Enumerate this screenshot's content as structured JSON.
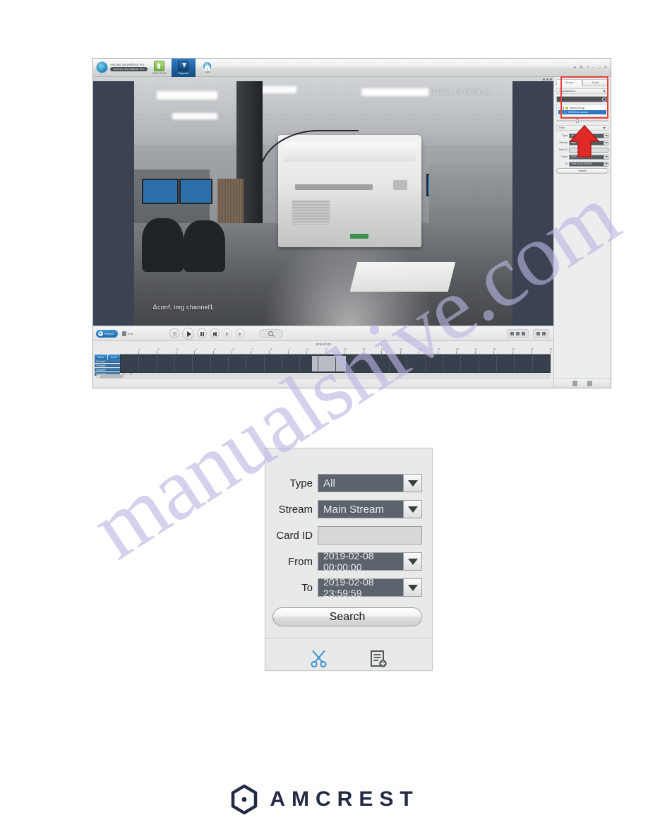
{
  "watermark": {
    "text": "manualshive.com"
  },
  "app": {
    "brand": {
      "name": "Amcrest Surveillance Pro",
      "subtitle": "Amcrest Surveillance Pro"
    },
    "tabs": [
      {
        "label": "HOME PAGE",
        "icon": "home-icon",
        "active": false
      },
      {
        "label": "Playback",
        "icon": "playback-icon",
        "active": true
      },
      {
        "label": "Add",
        "icon": "plus-icon",
        "active": false
      }
    ],
    "window_controls": [
      "minimize",
      "maximize",
      "close"
    ],
    "video": {
      "timestamp_overlay": "2019-02-08 08:08:04",
      "channel_overlay": "&conf. img channel1"
    },
    "controls": {
      "record_pill_label": "Record",
      "secondary_label": "Edit",
      "buttons": [
        "stop-button",
        "play-button",
        "pause-button",
        "next-frame-button",
        "slow-button",
        "fast-button"
      ],
      "search_icon": "magnifier-icon"
    },
    "timeline": {
      "date_label": "2019-02-08",
      "hours": [
        "1",
        "2",
        "3",
        "4",
        "5",
        "6",
        "7",
        "8",
        "9",
        "10",
        "11",
        "12",
        "13",
        "14",
        "15",
        "16",
        "17",
        "18",
        "19",
        "20",
        "21",
        "22",
        "23"
      ],
      "tabs": [
        "Device",
        "Event"
      ],
      "rows": [
        "Channel1",
        "Channel2",
        "Channel3",
        "Channel4"
      ]
    },
    "sidebar": {
      "tabs": [
        {
          "label": "Device",
          "active": true
        },
        {
          "label": "Local",
          "active": false
        }
      ],
      "section_label": "Organizations",
      "search_placeholder": "",
      "tree": [
        {
          "label": "Default Group",
          "type": "group",
          "selected": false
        },
        {
          "label": "IP2M-841 camera",
          "type": "camera",
          "selected": true
        }
      ],
      "filter_section_label": "Filter",
      "filter": {
        "type_label": "Type",
        "type_value": "All",
        "stream_label": "Stream",
        "stream_value": "Main Stream",
        "card_label": "Card ID",
        "card_value": "",
        "from_label": "From",
        "from_value": "2019-02-08 00:00:00",
        "to_label": "To",
        "to_value": "2019-02-08 23:59:59",
        "search_label": "Search"
      },
      "bottom_icons": [
        "clip-icon",
        "export-icon"
      ]
    }
  },
  "annotation": {
    "box_color": "#e8403a",
    "arrow_color": "#e02a28",
    "arrow_direction": "up"
  },
  "dialog": {
    "rows": [
      {
        "label": "Type",
        "value": "All",
        "has_arrow": true,
        "blank": false
      },
      {
        "label": "Stream",
        "value": "Main Stream",
        "has_arrow": true,
        "blank": false
      },
      {
        "label": "Card ID",
        "value": "",
        "has_arrow": false,
        "blank": true
      },
      {
        "label": "From",
        "value": "2019-02-08 00:00:00",
        "has_arrow": true,
        "blank": false
      },
      {
        "label": "To",
        "value": "2019-02-08 23:59:59",
        "has_arrow": true,
        "blank": false
      }
    ],
    "search_label": "Search",
    "icons": [
      {
        "name": "scissors-icon",
        "color": "#3f8fd0"
      },
      {
        "name": "export-report-icon",
        "color": "#55595c"
      }
    ]
  },
  "footer": {
    "logo_text": "AMCREST",
    "logo_color": "#232a45"
  }
}
